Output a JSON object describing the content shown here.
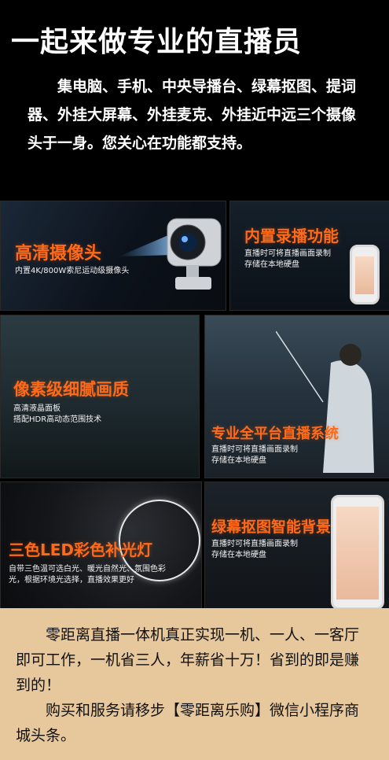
{
  "title": "一起来做专业的直播员",
  "intro": "集电脑、手机、中央导播台、绿幕抠图、提词器、外挂大屏幕、外挂麦克、外挂近中远三个摄像头于一身。您关心在功能都支持。",
  "panels": [
    {
      "head": "高清摄像头",
      "desc": "内置4K/800W索尼运动级摄像头"
    },
    {
      "head": "内置录播功能",
      "desc": "直播时可将直播画面录制\n存储在本地硬盘"
    },
    {
      "head": "像素级细腻画质",
      "desc": "高清液晶面板\n搭配HDR高动态范围技术"
    },
    {
      "head": "专业全平台直播系统",
      "desc": "直播时可将直播画面录制\n存储在本地硬盘"
    },
    {
      "head": "三色LED彩色补光灯",
      "desc": "自带三色温可选白光、暖光自然光、氛围色彩\n光，根据环境光选择，直播效果更好"
    },
    {
      "head": "绿幕抠图智能背景",
      "desc": "直播时可将直播画面录制\n存储在本地硬盘"
    }
  ],
  "footer": {
    "p1": "零距离直播一体机真正实现一机、一人、一客厅即可工作，一机省三人，年薪省十万！省到的即是赚到的！",
    "p2": "购买和服务请移步【零距离乐购】微信小程序商城头条。"
  },
  "colors": {
    "accent": "#ff6a1a",
    "footer_bg": "#e7c89d"
  }
}
